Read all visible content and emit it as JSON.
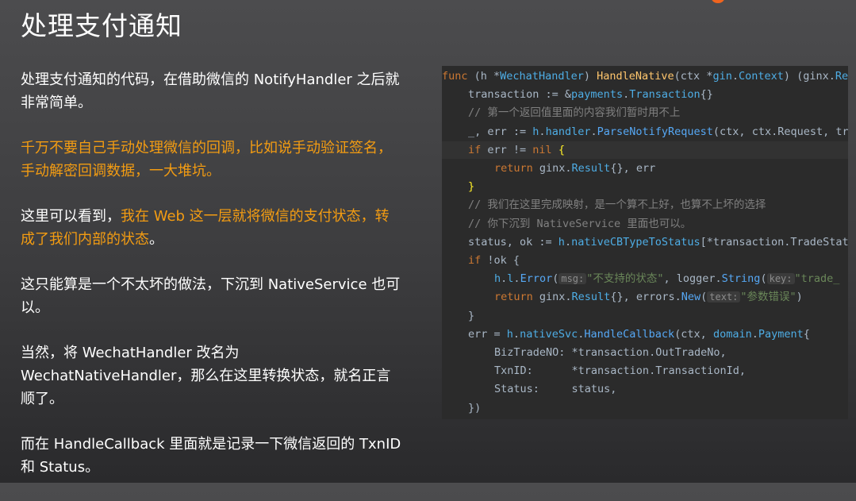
{
  "slide": {
    "title": "处理支付通知",
    "paragraphs": [
      [
        {
          "text": "处理支付通知的代码，在借助微信的 NotifyHandler 之后就非常简单。",
          "hl": false
        }
      ],
      [
        {
          "text": "千万不要自己手动处理微信的回调，比如说手动验证签名，手动解密回调数据，一大堆坑。",
          "hl": true
        }
      ],
      [
        {
          "text": "这里可以看到，",
          "hl": false
        },
        {
          "text": "我在 Web 这一层就将微信的支付状态，转成了我们内部的状态",
          "hl": true
        },
        {
          "text": "。",
          "hl": false
        }
      ],
      [
        {
          "text": "这只能算是一个不太坏的做法，下沉到 NativeService 也可以。",
          "hl": false
        }
      ],
      [
        {
          "text": "当然，将 WechatHandler 改名为 WechatNativeHandler，那么在这里转换状态，就名正言顺了。",
          "hl": false
        }
      ],
      [
        {
          "text": "而在 HandleCallback 里面就是记录一下微信返回的 TxnID 和 Status。",
          "hl": false
        }
      ]
    ]
  },
  "code": {
    "lines": [
      {
        "indent": 0,
        "hl": false,
        "tokens": [
          [
            "kw",
            "func "
          ],
          [
            "",
            "(h "
          ],
          [
            "",
            "*"
          ],
          [
            "ty",
            "WechatHandler"
          ],
          [
            "",
            ") "
          ],
          [
            "fn",
            "HandleNative"
          ],
          [
            "",
            "(ctx *"
          ],
          [
            "ty",
            "gin"
          ],
          [
            "",
            "."
          ],
          [
            "ty",
            "Context"
          ],
          [
            "",
            ") (ginx."
          ],
          [
            "ty",
            "Re"
          ]
        ]
      },
      {
        "indent": 1,
        "hl": false,
        "tokens": [
          [
            "",
            "transaction := &"
          ],
          [
            "ty",
            "payments"
          ],
          [
            "",
            "."
          ],
          [
            "ty",
            "Transaction"
          ],
          [
            "",
            "{}"
          ]
        ]
      },
      {
        "indent": 1,
        "hl": false,
        "tokens": [
          [
            "cm",
            "// 第一个返回值里面的内容我们暂时用不上"
          ]
        ]
      },
      {
        "indent": 1,
        "hl": false,
        "tokens": [
          [
            "",
            "_, err := "
          ],
          [
            "ty",
            "h"
          ],
          [
            "",
            "."
          ],
          [
            "ty",
            "handler"
          ],
          [
            "",
            "."
          ],
          [
            "mt",
            "ParseNotifyRequest"
          ],
          [
            "",
            "(ctx, ctx.Request, tr"
          ]
        ]
      },
      {
        "indent": 1,
        "hl": true,
        "tokens": [
          [
            "kw",
            "if "
          ],
          [
            "",
            "err != "
          ],
          [
            "kw",
            "nil "
          ],
          [
            "br",
            "{"
          ]
        ]
      },
      {
        "indent": 2,
        "hl": false,
        "tokens": [
          [
            "kw",
            "return "
          ],
          [
            "",
            "ginx."
          ],
          [
            "ty",
            "Result"
          ],
          [
            "",
            "{}, err"
          ]
        ]
      },
      {
        "indent": 1,
        "hl": false,
        "tokens": [
          [
            "br",
            "}"
          ]
        ]
      },
      {
        "indent": 1,
        "hl": false,
        "tokens": [
          [
            "cm",
            "// 我们在这里完成映射，是一个算不上好，也算不上坏的选择"
          ]
        ]
      },
      {
        "indent": 1,
        "hl": false,
        "tokens": [
          [
            "cm",
            "// 你下沉到 NativeService 里面也可以。"
          ]
        ]
      },
      {
        "indent": 1,
        "hl": false,
        "tokens": [
          [
            "",
            "status, ok := "
          ],
          [
            "ty",
            "h"
          ],
          [
            "",
            "."
          ],
          [
            "ty",
            "nativeCBTypeToStatus"
          ],
          [
            "",
            "[*transaction.TradeStat"
          ]
        ]
      },
      {
        "indent": 1,
        "hl": false,
        "tokens": [
          [
            "kw",
            "if "
          ],
          [
            "",
            "!ok {"
          ]
        ]
      },
      {
        "indent": 2,
        "hl": false,
        "tokens": [
          [
            "ty",
            "h"
          ],
          [
            "",
            "."
          ],
          [
            "ty",
            "l"
          ],
          [
            "",
            "."
          ],
          [
            "mt",
            "Error"
          ],
          [
            "",
            "("
          ],
          [
            "hint",
            "msg:"
          ],
          [
            "st",
            "\"不支持的状态\""
          ],
          [
            "",
            ", logger."
          ],
          [
            "mt",
            "String"
          ],
          [
            "",
            "("
          ],
          [
            "hint",
            "key:"
          ],
          [
            "st",
            "\"trade_"
          ]
        ]
      },
      {
        "indent": 2,
        "hl": false,
        "tokens": [
          [
            "kw",
            "return "
          ],
          [
            "",
            "ginx."
          ],
          [
            "ty",
            "Result"
          ],
          [
            "",
            "{}, errors."
          ],
          [
            "mt",
            "New"
          ],
          [
            "",
            "("
          ],
          [
            "hint",
            "text:"
          ],
          [
            "st",
            "\"参数错误\""
          ],
          [
            "",
            ")"
          ]
        ]
      },
      {
        "indent": 1,
        "hl": false,
        "tokens": [
          [
            "",
            "}"
          ]
        ]
      },
      {
        "indent": 1,
        "hl": false,
        "tokens": [
          [
            "",
            "err = "
          ],
          [
            "ty",
            "h"
          ],
          [
            "",
            "."
          ],
          [
            "ty",
            "nativeSvc"
          ],
          [
            "",
            "."
          ],
          [
            "mt",
            "HandleCallback"
          ],
          [
            "",
            "(ctx, "
          ],
          [
            "ty",
            "domain"
          ],
          [
            "",
            "."
          ],
          [
            "ty",
            "Payment"
          ],
          [
            "",
            "{"
          ]
        ]
      },
      {
        "indent": 2,
        "hl": false,
        "tokens": [
          [
            "",
            "BizTradeNO: *transaction.OutTradeNo,"
          ]
        ]
      },
      {
        "indent": 2,
        "hl": false,
        "tokens": [
          [
            "",
            "TxnID:      *transaction.TransactionId,"
          ]
        ]
      },
      {
        "indent": 2,
        "hl": false,
        "tokens": [
          [
            "",
            "Status:     status,"
          ]
        ]
      },
      {
        "indent": 1,
        "hl": false,
        "tokens": [
          [
            "",
            "})"
          ]
        ]
      }
    ]
  }
}
